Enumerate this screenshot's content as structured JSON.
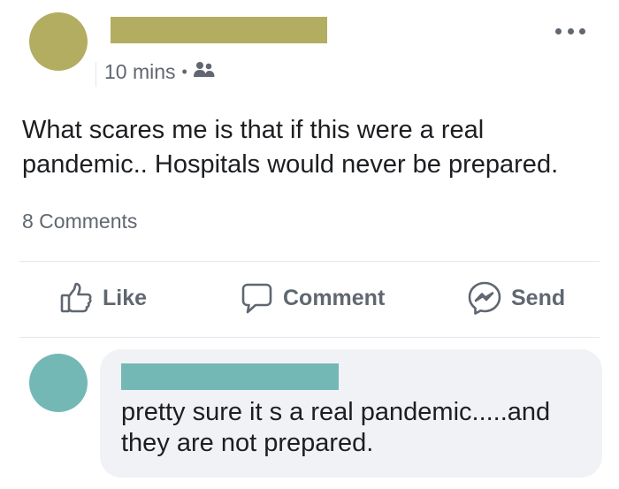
{
  "colors": {
    "author_redaction": "#b3ad62",
    "commenter_redaction": "#74b8b5",
    "secondary_text": "#606770"
  },
  "post": {
    "timestamp": "10 mins",
    "separator": "•",
    "audience_icon": "friends-icon",
    "more_icon": "more-options-icon",
    "text_lines": [
      "What scares me is that if this were a real",
      "pandemic.. Hospitals would never be prepared."
    ],
    "comments_count": "8 Comments"
  },
  "actions": {
    "like": {
      "label": "Like",
      "icon": "thumbs-up-icon"
    },
    "comment": {
      "label": "Comment",
      "icon": "speech-bubble-icon"
    },
    "send": {
      "label": "Send",
      "icon": "messenger-icon"
    }
  },
  "comment": {
    "text_lines": [
      "pretty sure it s a real pandemic.....and",
      "they are not prepared."
    ]
  }
}
